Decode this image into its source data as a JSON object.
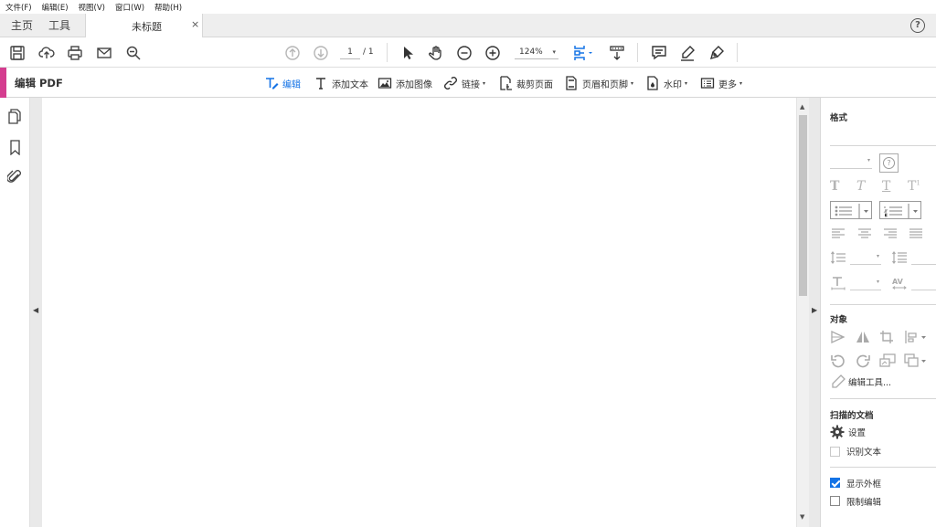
{
  "menu": [
    "文件(F)",
    "编辑(E)",
    "视图(V)",
    "窗口(W)",
    "帮助(H)"
  ],
  "tabs": {
    "home": "主页",
    "tools": "工具",
    "document": "未标题",
    "close": "×"
  },
  "help": "?",
  "toolbar": {
    "page_current": "1",
    "page_total": "/ 1",
    "zoom": "124%",
    "dropdown_arrow": "▾"
  },
  "editbar": {
    "mode_title": "编辑 PDF",
    "tools": {
      "edit": "编辑",
      "add_text": "添加文本",
      "add_image": "添加图像",
      "link": "链接",
      "crop": "裁剪页面",
      "header_footer": "页眉和页脚",
      "watermark": "水印",
      "more": "更多"
    },
    "dropdown_arrow": "▾"
  },
  "panel": {
    "format": {
      "heading": "格式",
      "help": "?"
    },
    "objects": {
      "heading": "对象",
      "edit_tools": "编辑工具..."
    },
    "scanned": {
      "heading": "扫描的文档",
      "settings": "设置",
      "recognize_text": "识别文本"
    },
    "options": {
      "show_bbox": {
        "label": "显示外框",
        "checked": true
      },
      "restrict_edit": {
        "label": "限制编辑",
        "checked": false
      }
    }
  },
  "colors": {
    "accent": "#d43d8f",
    "active_blue": "#1473e6"
  }
}
